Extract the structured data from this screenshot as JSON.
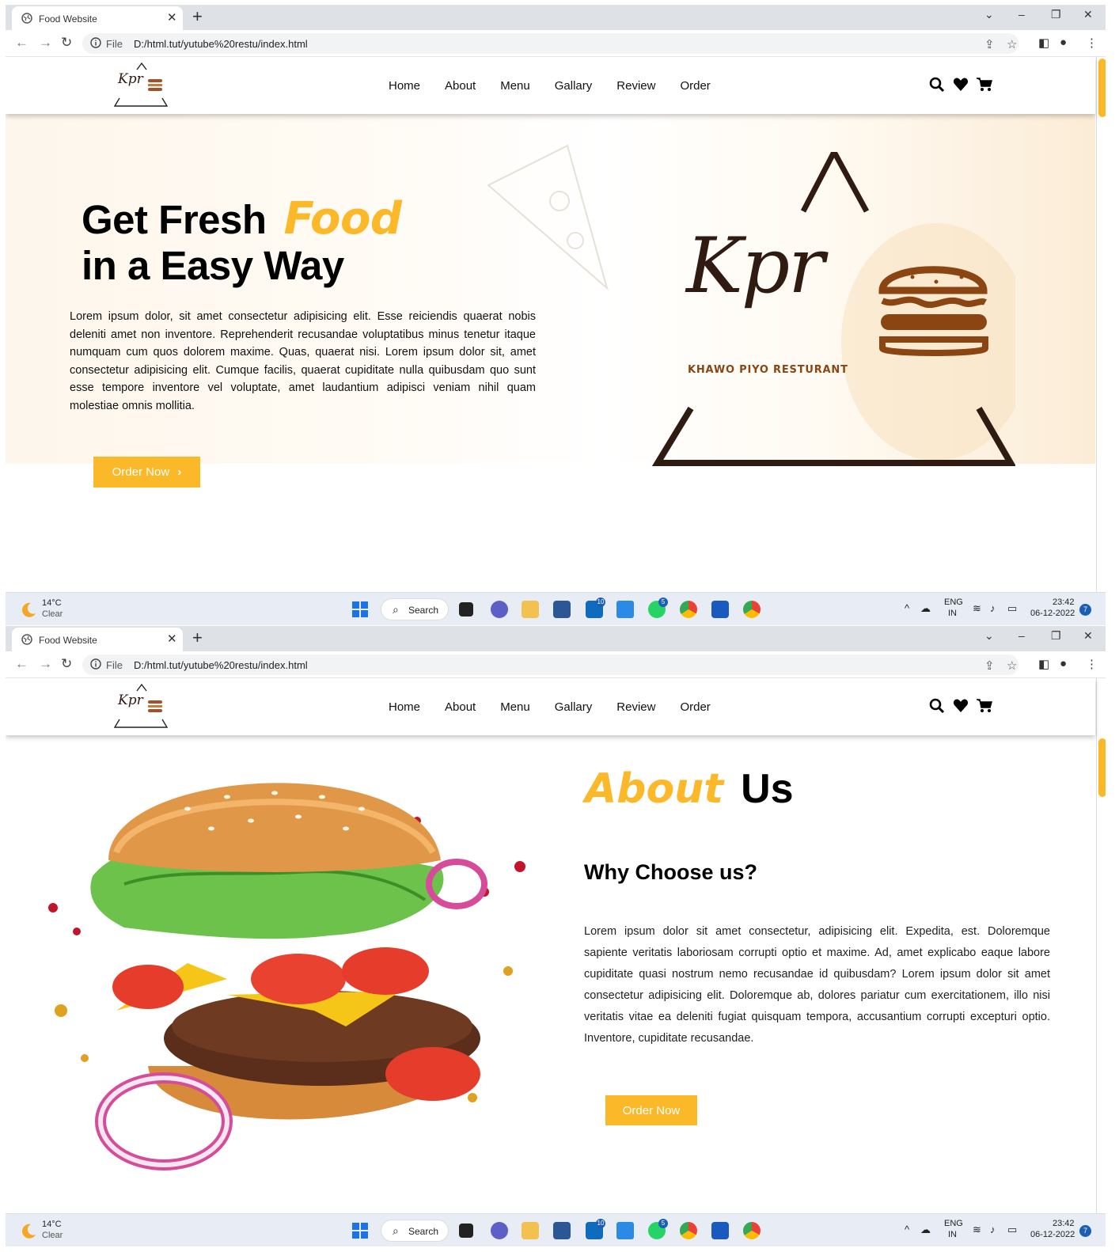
{
  "browser": {
    "tab_title": "Food Website",
    "url_scheme_label": "File",
    "url": "D:/html.tut/yutube%20restu/index.html"
  },
  "site": {
    "logo_text": "Kpr",
    "nav": [
      "Home",
      "About",
      "Menu",
      "Gallary",
      "Review",
      "Order"
    ]
  },
  "hero": {
    "title_part1": "Get Fresh",
    "title_accent": "Food",
    "title_line2": "in a Easy Way",
    "paragraph": "Lorem ipsum dolor, sit amet consectetur adipisicing elit. Esse reiciendis quaerat nobis deleniti amet non inventore. Reprehenderit recusandae voluptatibus minus tenetur itaque numquam cum quos dolorem maxime. Quas, quaerat nisi. Lorem ipsum dolor sit, amet consectetur adipisicing elit. Cumque facilis, quaerat cupiditate nulla quibusdam quo sunt esse tempore inventore vel voluptate, amet laudantium adipisci veniam nihil quam molestiae omnis mollitia.",
    "order_button": "Order Now",
    "order_button_chevron": "›",
    "logo_brand": "Kpr",
    "logo_tagline": "KHAWO PIYO RESTURANT"
  },
  "about": {
    "title_accent": "About",
    "title_rest": "Us",
    "subtitle": "Why Choose us?",
    "paragraph": "Lorem ipsum dolor sit amet consectetur, adipisicing elit. Expedita, est. Doloremque sapiente veritatis laboriosam corrupti optio et maxime. Ad, amet explicabo eaque labore cupiditate quasi nostrum nemo recusandae id quibusdam? Lorem ipsum dolor sit amet consectetur adipisicing elit. Doloremque ab, dolores pariatur cum exercitationem, illo nisi veritatis vitae ea deleniti fugiat quisquam tempora, accusantium corrupti excepturi optio. Inventore, cupiditate recusandae.",
    "order_button": "Order Now"
  },
  "taskbar": {
    "temperature": "14°C",
    "condition": "Clear",
    "search_label": "Search",
    "lang_top": "ENG",
    "lang_bottom": "IN",
    "time": "23:42",
    "date": "06-12-2022",
    "notification_count": "7",
    "badge_outlook": "10",
    "badge_whatsapp": "5"
  },
  "colors": {
    "accent": "#fbb829",
    "brand_brown": "#2f1b12",
    "tagline_brown": "#8b4513"
  }
}
